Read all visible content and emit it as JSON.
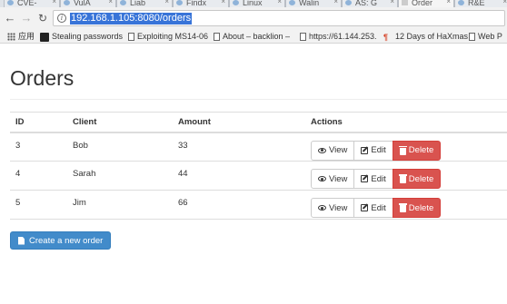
{
  "browser": {
    "tabs": [
      {
        "label": "CVE-",
        "icon": "globe-icon"
      },
      {
        "label": "VulA",
        "icon": "globe-icon"
      },
      {
        "label": "Liab",
        "icon": "globe-icon"
      },
      {
        "label": "Findx",
        "icon": "globe-icon"
      },
      {
        "label": "Linux",
        "icon": "globe-icon"
      },
      {
        "label": "Walin",
        "icon": "globe-icon"
      },
      {
        "label": "AS: G",
        "icon": "globe-icon"
      },
      {
        "label": "Order",
        "icon": "page-icon"
      },
      {
        "label": "R&E",
        "icon": "globe-icon"
      }
    ],
    "url": "192.168.1.105:8080/orders",
    "bookmarks": [
      {
        "label": "应用",
        "icon": "apps-grid-icon"
      },
      {
        "label": "Stealing passwords",
        "icon": "bookmark-dark-icon"
      },
      {
        "label": "Exploiting MS14-06",
        "icon": "page-icon"
      },
      {
        "label": "About – backlion –",
        "icon": "page-icon"
      },
      {
        "label": "https://61.144.253.",
        "icon": "page-icon"
      },
      {
        "label": "12 Days of HaXmas",
        "icon": "bookmark-red-icon"
      },
      {
        "label": "Web P",
        "icon": "page-icon"
      }
    ]
  },
  "page": {
    "title": "Orders",
    "columns": {
      "id": "ID",
      "client": "Client",
      "amount": "Amount",
      "actions": "Actions"
    },
    "orders": [
      {
        "id": "3",
        "client": "Bob",
        "amount": "33"
      },
      {
        "id": "4",
        "client": "Sarah",
        "amount": "44"
      },
      {
        "id": "5",
        "client": "Jim",
        "amount": "66"
      }
    ],
    "actions": {
      "view": "View",
      "edit": "Edit",
      "delete": "Delete"
    },
    "create_label": "Create a new order"
  },
  "colors": {
    "danger": "#d9534f",
    "primary": "#428bca",
    "url_highlight": "#3874d8"
  }
}
